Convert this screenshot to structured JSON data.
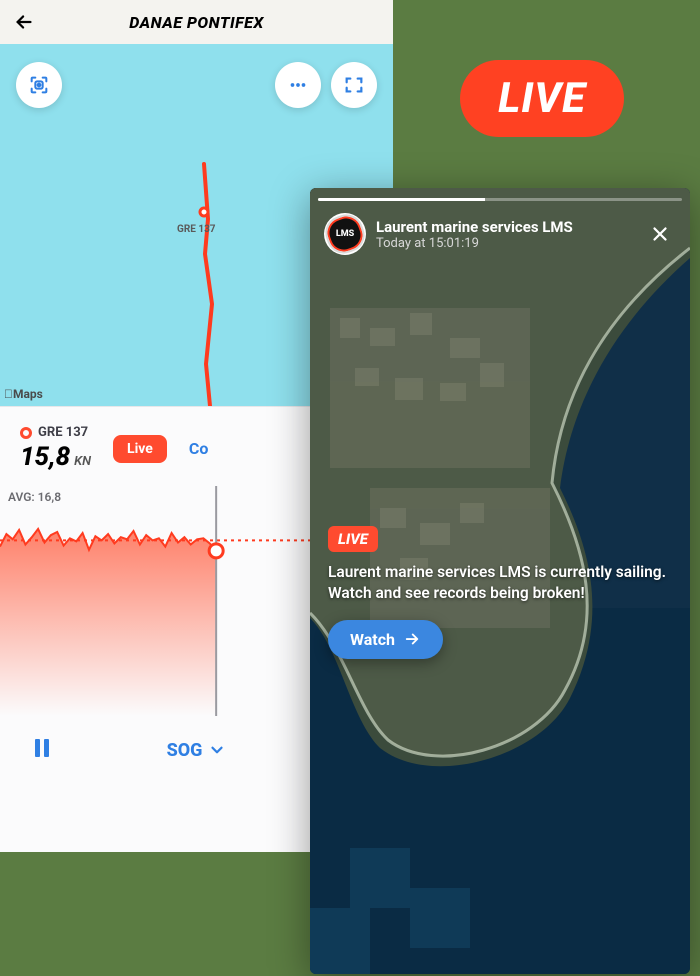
{
  "live_pill": "LIVE",
  "left": {
    "title": "DANAE PONTIFEX",
    "map_route_label": "GRE 137",
    "map_attribution": "Maps",
    "icons": {
      "scan": "scan-icon",
      "more": "more-icon",
      "fullscreen": "fullscreen-icon",
      "back": "back-arrow-icon"
    },
    "stat": {
      "label": "GRE 137",
      "value": "15,8",
      "unit": "KN"
    },
    "live_badge": "Live",
    "other_metric_peek": "Co",
    "avg_label": "AVG: 16,8",
    "metric_selector": "SOG",
    "footer_icons": {
      "pause": "pause-icon",
      "chevron": "chevron-down-icon"
    }
  },
  "right": {
    "org_name": "Laurent marine services LMS",
    "timestamp": "Today at 15:01:19",
    "avatar_text": "LMS",
    "live_chip": "LIVE",
    "cta_text": "Laurent marine services LMS is currently sailing. Watch and see records being broken!",
    "watch_label": "Watch",
    "progress_pct": 46
  },
  "chart_data": {
    "type": "area",
    "title": "Speed over ground",
    "ylabel": "KN",
    "ylim": [
      0,
      22
    ],
    "avg": 16.8,
    "x": [
      0,
      1,
      2,
      3,
      4,
      5,
      6,
      7,
      8,
      9,
      10,
      11,
      12,
      13,
      14,
      15,
      16,
      17,
      18,
      19,
      20,
      21,
      22,
      23,
      24,
      25,
      26,
      27,
      28,
      29,
      30,
      31,
      32,
      33,
      34
    ],
    "values": [
      16.2,
      17.4,
      16.9,
      17.8,
      16.4,
      17.1,
      17.9,
      16.6,
      17.3,
      17.6,
      16.3,
      17.0,
      16.7,
      17.5,
      15.9,
      17.2,
      16.8,
      17.4,
      16.5,
      17.1,
      16.9,
      17.7,
      16.4,
      17.3,
      16.8,
      17.0,
      16.2,
      17.5,
      16.6,
      17.1,
      16.4,
      16.9,
      17.0,
      16.5,
      15.8
    ],
    "cursor_index": 34,
    "cursor_value": 15.8
  }
}
